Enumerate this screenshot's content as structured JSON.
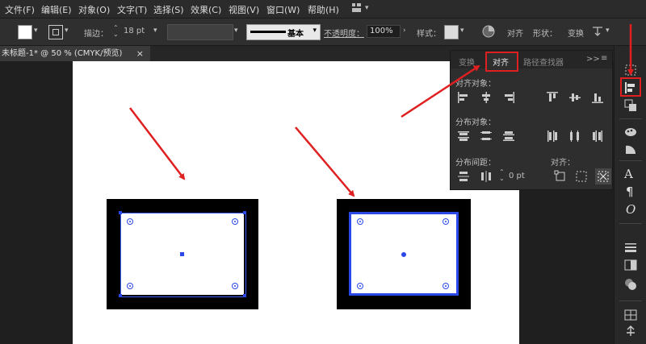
{
  "menubar": {
    "items": [
      "文件(F)",
      "编辑(E)",
      "对象(O)",
      "文字(T)",
      "选择(S)",
      "效果(C)",
      "视图(V)",
      "窗口(W)",
      "帮助(H)"
    ]
  },
  "control_bar": {
    "stroke_label": "描边：",
    "stroke_value": "18 pt",
    "brush_label": "基本",
    "opacity_label": "不透明度：",
    "opacity_value": "100%",
    "style_label": "样式：",
    "align_label": "对齐",
    "shape_label": "形状：",
    "transform_label": "变换"
  },
  "document": {
    "tab_title": "未标题-1* @ 50 % (CMYK/预览)",
    "close": "×"
  },
  "panel": {
    "tabs": [
      "变换",
      "对齐",
      "路径查找器"
    ],
    "active_tab": "对齐",
    "more": ">>",
    "menu": "≡",
    "align_objects_label": "对齐对象：",
    "distribute_objects_label": "分布对象：",
    "distribute_spacing_label": "分布间距：",
    "align_to_label": "对齐：",
    "spacing_value": "0 pt"
  },
  "colors": {
    "accent_red": "#e02020",
    "selection_blue": "#2b48e8",
    "ui_dark": "#2e2e2e"
  }
}
